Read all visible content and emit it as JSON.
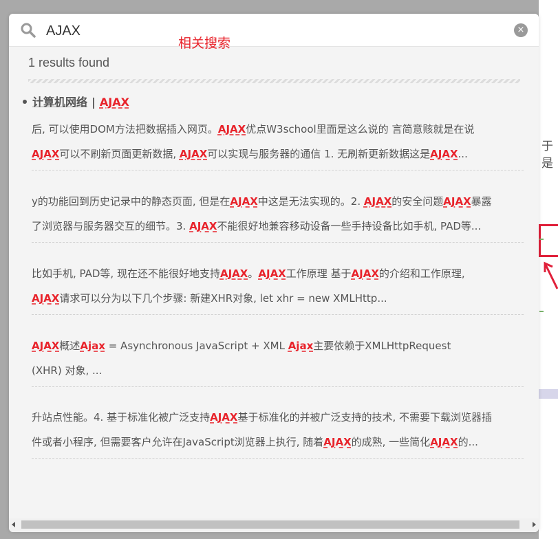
{
  "search": {
    "value": "AJAX",
    "annotation": "相关搜索",
    "clear_label": "×"
  },
  "results_count": "1 results found",
  "background": {
    "partial_char": "于是"
  },
  "result": {
    "category": "计算机网络",
    "separator": "|",
    "title_keyword": "AJAX",
    "snippets": [
      {
        "lines": [
          [
            {
              "t": "后, 可以使用DOM方法把数据插入网页。",
              "h": false
            },
            {
              "t": "AJAX",
              "h": true
            },
            {
              "t": "优点W3school里面是这么说的 言简意赅就是在说",
              "h": false
            }
          ],
          [
            {
              "t": "AJAX",
              "h": true
            },
            {
              "t": "可以不刷新页面更新数据, ",
              "h": false
            },
            {
              "t": "AJAX",
              "h": true
            },
            {
              "t": "可以实现与服务器的通信 1. 无刷新更新数据这是",
              "h": false
            },
            {
              "t": "AJAX",
              "h": true
            },
            {
              "t": "...",
              "h": false
            }
          ]
        ]
      },
      {
        "lines": [
          [
            {
              "t": "y的功能回到历史记录中的静态页面, 但是在",
              "h": false
            },
            {
              "t": "AJAX",
              "h": true
            },
            {
              "t": "中这是无法实现的。2. ",
              "h": false
            },
            {
              "t": "AJAX",
              "h": true
            },
            {
              "t": "的安全问题",
              "h": false
            },
            {
              "t": "AJAX",
              "h": true
            },
            {
              "t": "暴露",
              "h": false
            }
          ],
          [
            {
              "t": "了浏览器与服务器交互的细节。3. ",
              "h": false
            },
            {
              "t": "AJAX",
              "h": true
            },
            {
              "t": "不能很好地兼容移动设备一些手持设备比如手机, PAD等...",
              "h": false
            }
          ]
        ]
      },
      {
        "lines": [
          [
            {
              "t": "比如手机, PAD等, 现在还不能很好地支持",
              "h": false
            },
            {
              "t": "AJAX",
              "h": true
            },
            {
              "t": "。",
              "h": false
            },
            {
              "t": "AJAX",
              "h": true
            },
            {
              "t": "工作原理 基于",
              "h": false
            },
            {
              "t": "AJAX",
              "h": true
            },
            {
              "t": "的介绍和工作原理,",
              "h": false
            }
          ],
          [
            {
              "t": "AJAX",
              "h": true
            },
            {
              "t": "请求可以分为以下几个步骤: 新建XHR对象, let xhr = new XMLHttp...",
              "h": false
            }
          ]
        ]
      },
      {
        "lines": [
          [
            {
              "t": "AJAX",
              "h": true
            },
            {
              "t": "概述",
              "h": false
            },
            {
              "t": "Ajax",
              "h": true
            },
            {
              "t": " = Asynchronous JavaScript + XML ",
              "h": false
            },
            {
              "t": "Ajax",
              "h": true
            },
            {
              "t": "主要依赖于XMLHttpRequest",
              "h": false
            }
          ],
          [
            {
              "t": "(XHR) 对象, ...",
              "h": false
            }
          ]
        ]
      },
      {
        "lines": [
          [
            {
              "t": "升站点性能。4. 基于标准化被广泛支持",
              "h": false
            },
            {
              "t": "AJAX",
              "h": true
            },
            {
              "t": "基于标准化的并被广泛支持的技术, 不需要下载浏览器插",
              "h": false
            }
          ],
          [
            {
              "t": "件或者小程序, 但需要客户允许在JavaScript浏览器上执行, 随着",
              "h": false
            },
            {
              "t": "AJAX",
              "h": true
            },
            {
              "t": "的成熟, 一些简化",
              "h": false
            },
            {
              "t": "AJAX",
              "h": true
            },
            {
              "t": "的...",
              "h": false
            }
          ]
        ]
      }
    ]
  },
  "colors": {
    "highlight": "#e8232b",
    "overlay": "#a9a9a9",
    "modal_bg": "#f4f4f4"
  }
}
